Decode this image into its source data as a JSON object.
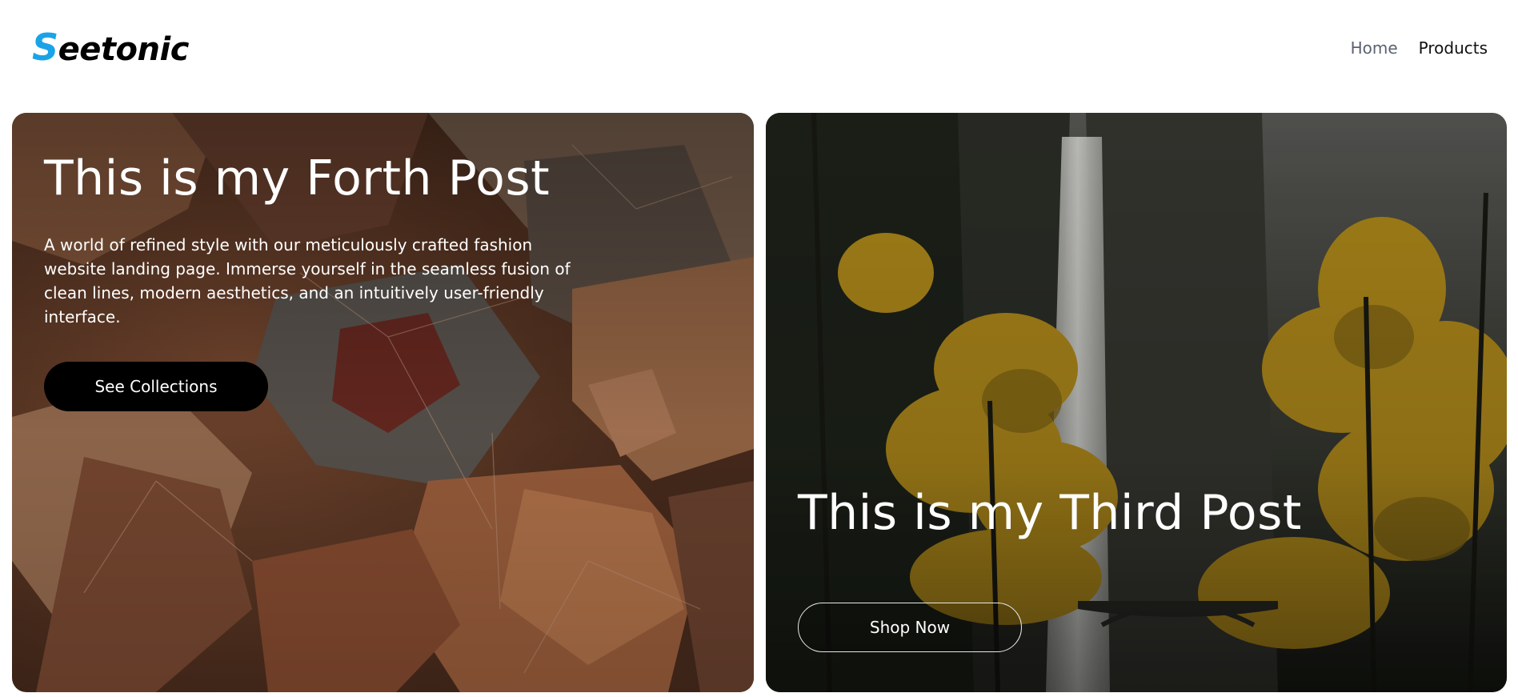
{
  "header": {
    "logo_first_letter": "S",
    "logo_rest": "eetonic",
    "nav": {
      "home": "Home",
      "products": "Products"
    }
  },
  "cards": [
    {
      "title": "This is my Forth Post",
      "description": "A world of refined style with our meticulously crafted fashion website landing page. Immerse yourself in the seamless fusion of clean lines, modern aesthetics, and an intuitively user-friendly interface.",
      "button_label": "See Collections",
      "image": "autumn-leaves-photo"
    },
    {
      "title": "This is my Third Post",
      "button_label": "Shop Now",
      "image": "waterfall-forest-photo"
    }
  ],
  "colors": {
    "logo_accent": "#1aa3e8",
    "nav_active": "#5b6270",
    "button_primary": "#000000"
  }
}
